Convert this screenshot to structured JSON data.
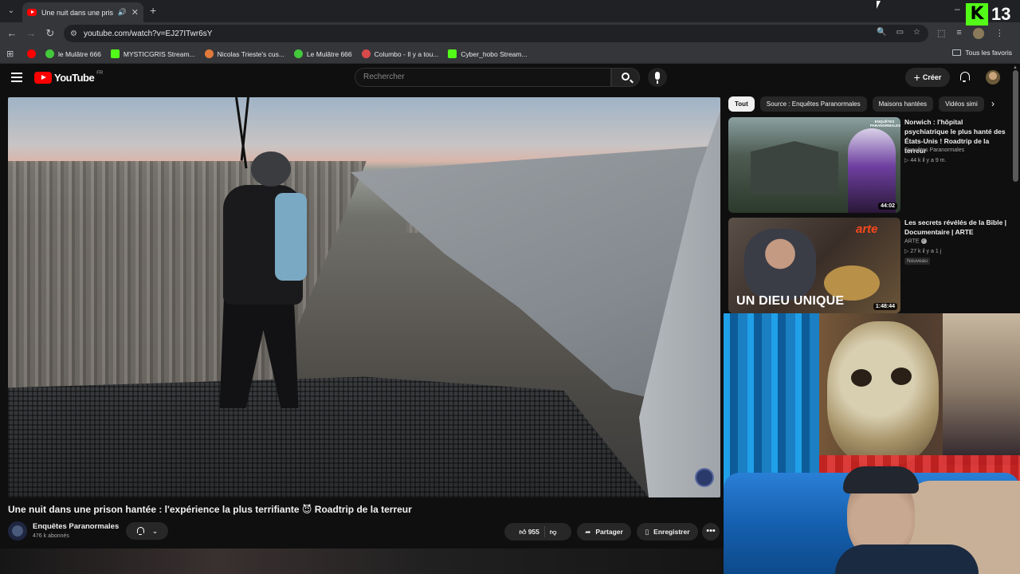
{
  "browser": {
    "tab_title": "Une nuit dans une prison h",
    "url": "youtube.com/watch?v=EJ27ITwr6sY",
    "bookmarks": [
      {
        "label": "",
        "icon": "youtube-icon"
      },
      {
        "label": "le Mulâtre 666",
        "icon": "green-play-icon"
      },
      {
        "label": "MYSTICGRIS Stream...",
        "icon": "kick-icon"
      },
      {
        "label": "Nicolas Trieste's cus...",
        "icon": "fox-icon"
      },
      {
        "label": "Le Mulâtre 666",
        "icon": "green-play-icon"
      },
      {
        "label": "Columbo - Il y a tou...",
        "icon": "red-circle-icon"
      },
      {
        "label": "Cyber_hobo Stream...",
        "icon": "kick-icon"
      }
    ],
    "all_bookmarks_label": "Tous les favoris"
  },
  "overlay_badge": {
    "letter": "K",
    "number": "13",
    "accent": "#53fc18"
  },
  "youtube": {
    "logo_text": "YouTube",
    "logo_region": "FR",
    "search_placeholder": "Rechercher",
    "create_label": "Créer",
    "brand_color": "#ff0000"
  },
  "video": {
    "title": "Une nuit dans une prison hantée : l'expérience la plus terrifiante 😈 Roadtrip de la terreur",
    "channel": "Enquêtes Paranormales",
    "subscribers": "476 k abonnés",
    "likes": "955",
    "share_label": "Partager",
    "save_label": "Enregistrer"
  },
  "chips": [
    {
      "label": "Tout",
      "active": true
    },
    {
      "label": "Source : Enquêtes Paranormales",
      "active": false
    },
    {
      "label": "Maisons hantées",
      "active": false
    },
    {
      "label": "Vidéos simi",
      "active": false
    }
  ],
  "recommendations": [
    {
      "title": "Norwich : l'hôpital psychiatrique le plus hanté des États-Unis ! Roadtrip de la terreur",
      "channel": "Enquêtes Paranormales",
      "meta": "▷ 44 k   il y a 9 m.",
      "duration": "44:02",
      "thumb_brand": "ENQUÊTES PARANORMALES"
    },
    {
      "title": "Les secrets révélés de la Bible | Documentaire | ARTE",
      "channel": "ARTE",
      "meta": "▷ 27 k   il y a 1 j",
      "badge": "Nouveau",
      "duration": "1:48:44",
      "thumb_logo": "arte",
      "thumb_caption": "UN DIEU UNIQUE"
    }
  ]
}
